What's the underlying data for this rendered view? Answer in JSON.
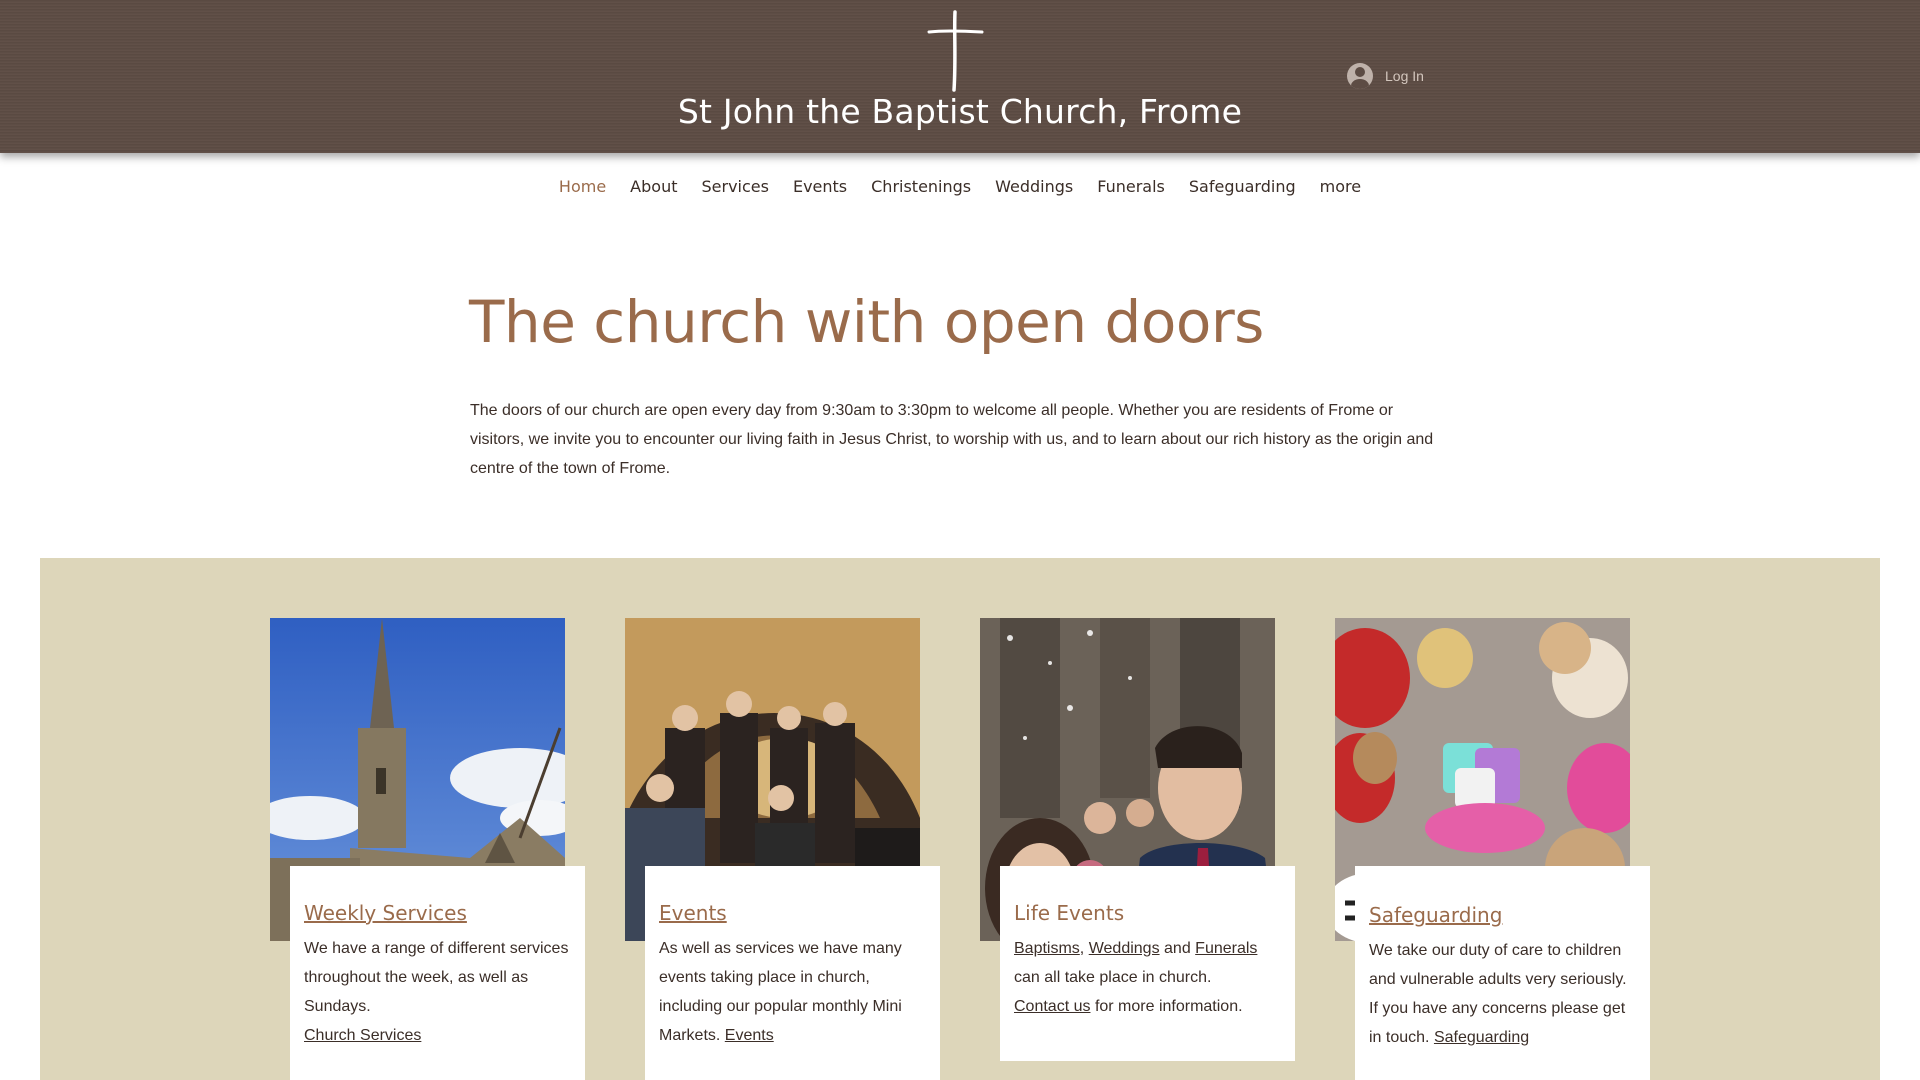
{
  "header": {
    "site_title": "St John the Baptist Church, Frome",
    "login_label": "Log In",
    "logo_icon": "cross-icon",
    "bg_color": "#5d4c44"
  },
  "nav": {
    "items": [
      "Home",
      "About",
      "Services",
      "Events",
      "Christenings",
      "Weddings",
      "Funerals",
      "Safeguarding",
      "more"
    ],
    "active": "Home",
    "accent_color": "#9a6b4b"
  },
  "hero": {
    "title": "The church with open doors",
    "text": "The doors of our church are open every day from 9:30am to 3:30pm to welcome all people. Whether you are residents of Frome or visitors, we invite you to encounter our living faith in Jesus Christ, to worship with us, and to learn about our rich history as the origin and centre of the town of Frome."
  },
  "cards": [
    {
      "title": "Weekly Services",
      "text": "We have a range of different services throughout the week, as well as Sundays.",
      "link": "Church Services"
    },
    {
      "title": "Events",
      "text": "As well as services we have many events taking place in church, including our popular monthly Mini Markets.",
      "link": "Events"
    },
    {
      "title": "Life Events",
      "link_baptisms": "Baptisms",
      "sep_comma": ",",
      "link_weddings": "Weddings",
      "word_and": "and",
      "link_funerals": "Funerals",
      "text_after": "can all take place in church.",
      "link_contact": "Contact us",
      "text_contact_after": "for more information."
    },
    {
      "title": "Safeguarding",
      "text": "We take our duty of care to children and vulnerable adults very seriously. If you have any concerns please get in touch.",
      "link": "Safeguarding"
    }
  ],
  "band_color": "#ddd6ba"
}
